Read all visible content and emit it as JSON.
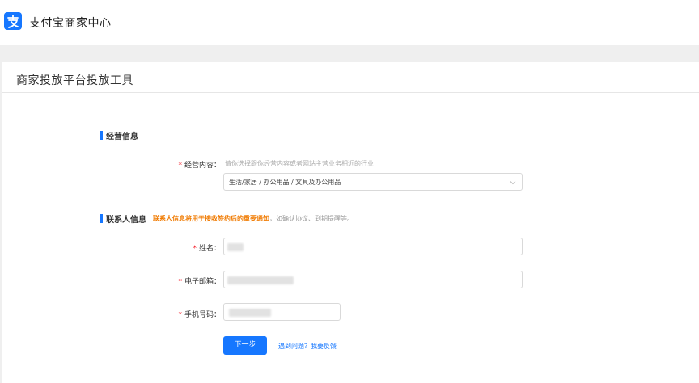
{
  "header": {
    "brand": "支付宝商家中心",
    "logo_icon": "alipay-logo-icon",
    "accent": "#1677ff"
  },
  "card": {
    "title": "商家投放平台投放工具"
  },
  "business_section": {
    "title": "经营信息",
    "content_label": "经营内容",
    "content_hint": "请你选择跟你经营内容或者网站主营业务相近的行业",
    "content_value": "生活/家居 / 办公用品 / 文具及办公用品"
  },
  "contact_section": {
    "title": "联系人信息",
    "notice_strong": "联系人信息将用于接收签约后的重要通知",
    "notice_rest": "，如确认协议、到期提醒等。",
    "name_label": "姓名",
    "email_label": "电子邮箱",
    "phone_label": "手机号码"
  },
  "actions": {
    "next_label": "下一步",
    "feedback_link": "遇到问题？我要反馈"
  },
  "required_mark": "*",
  "label_suffix": "："
}
